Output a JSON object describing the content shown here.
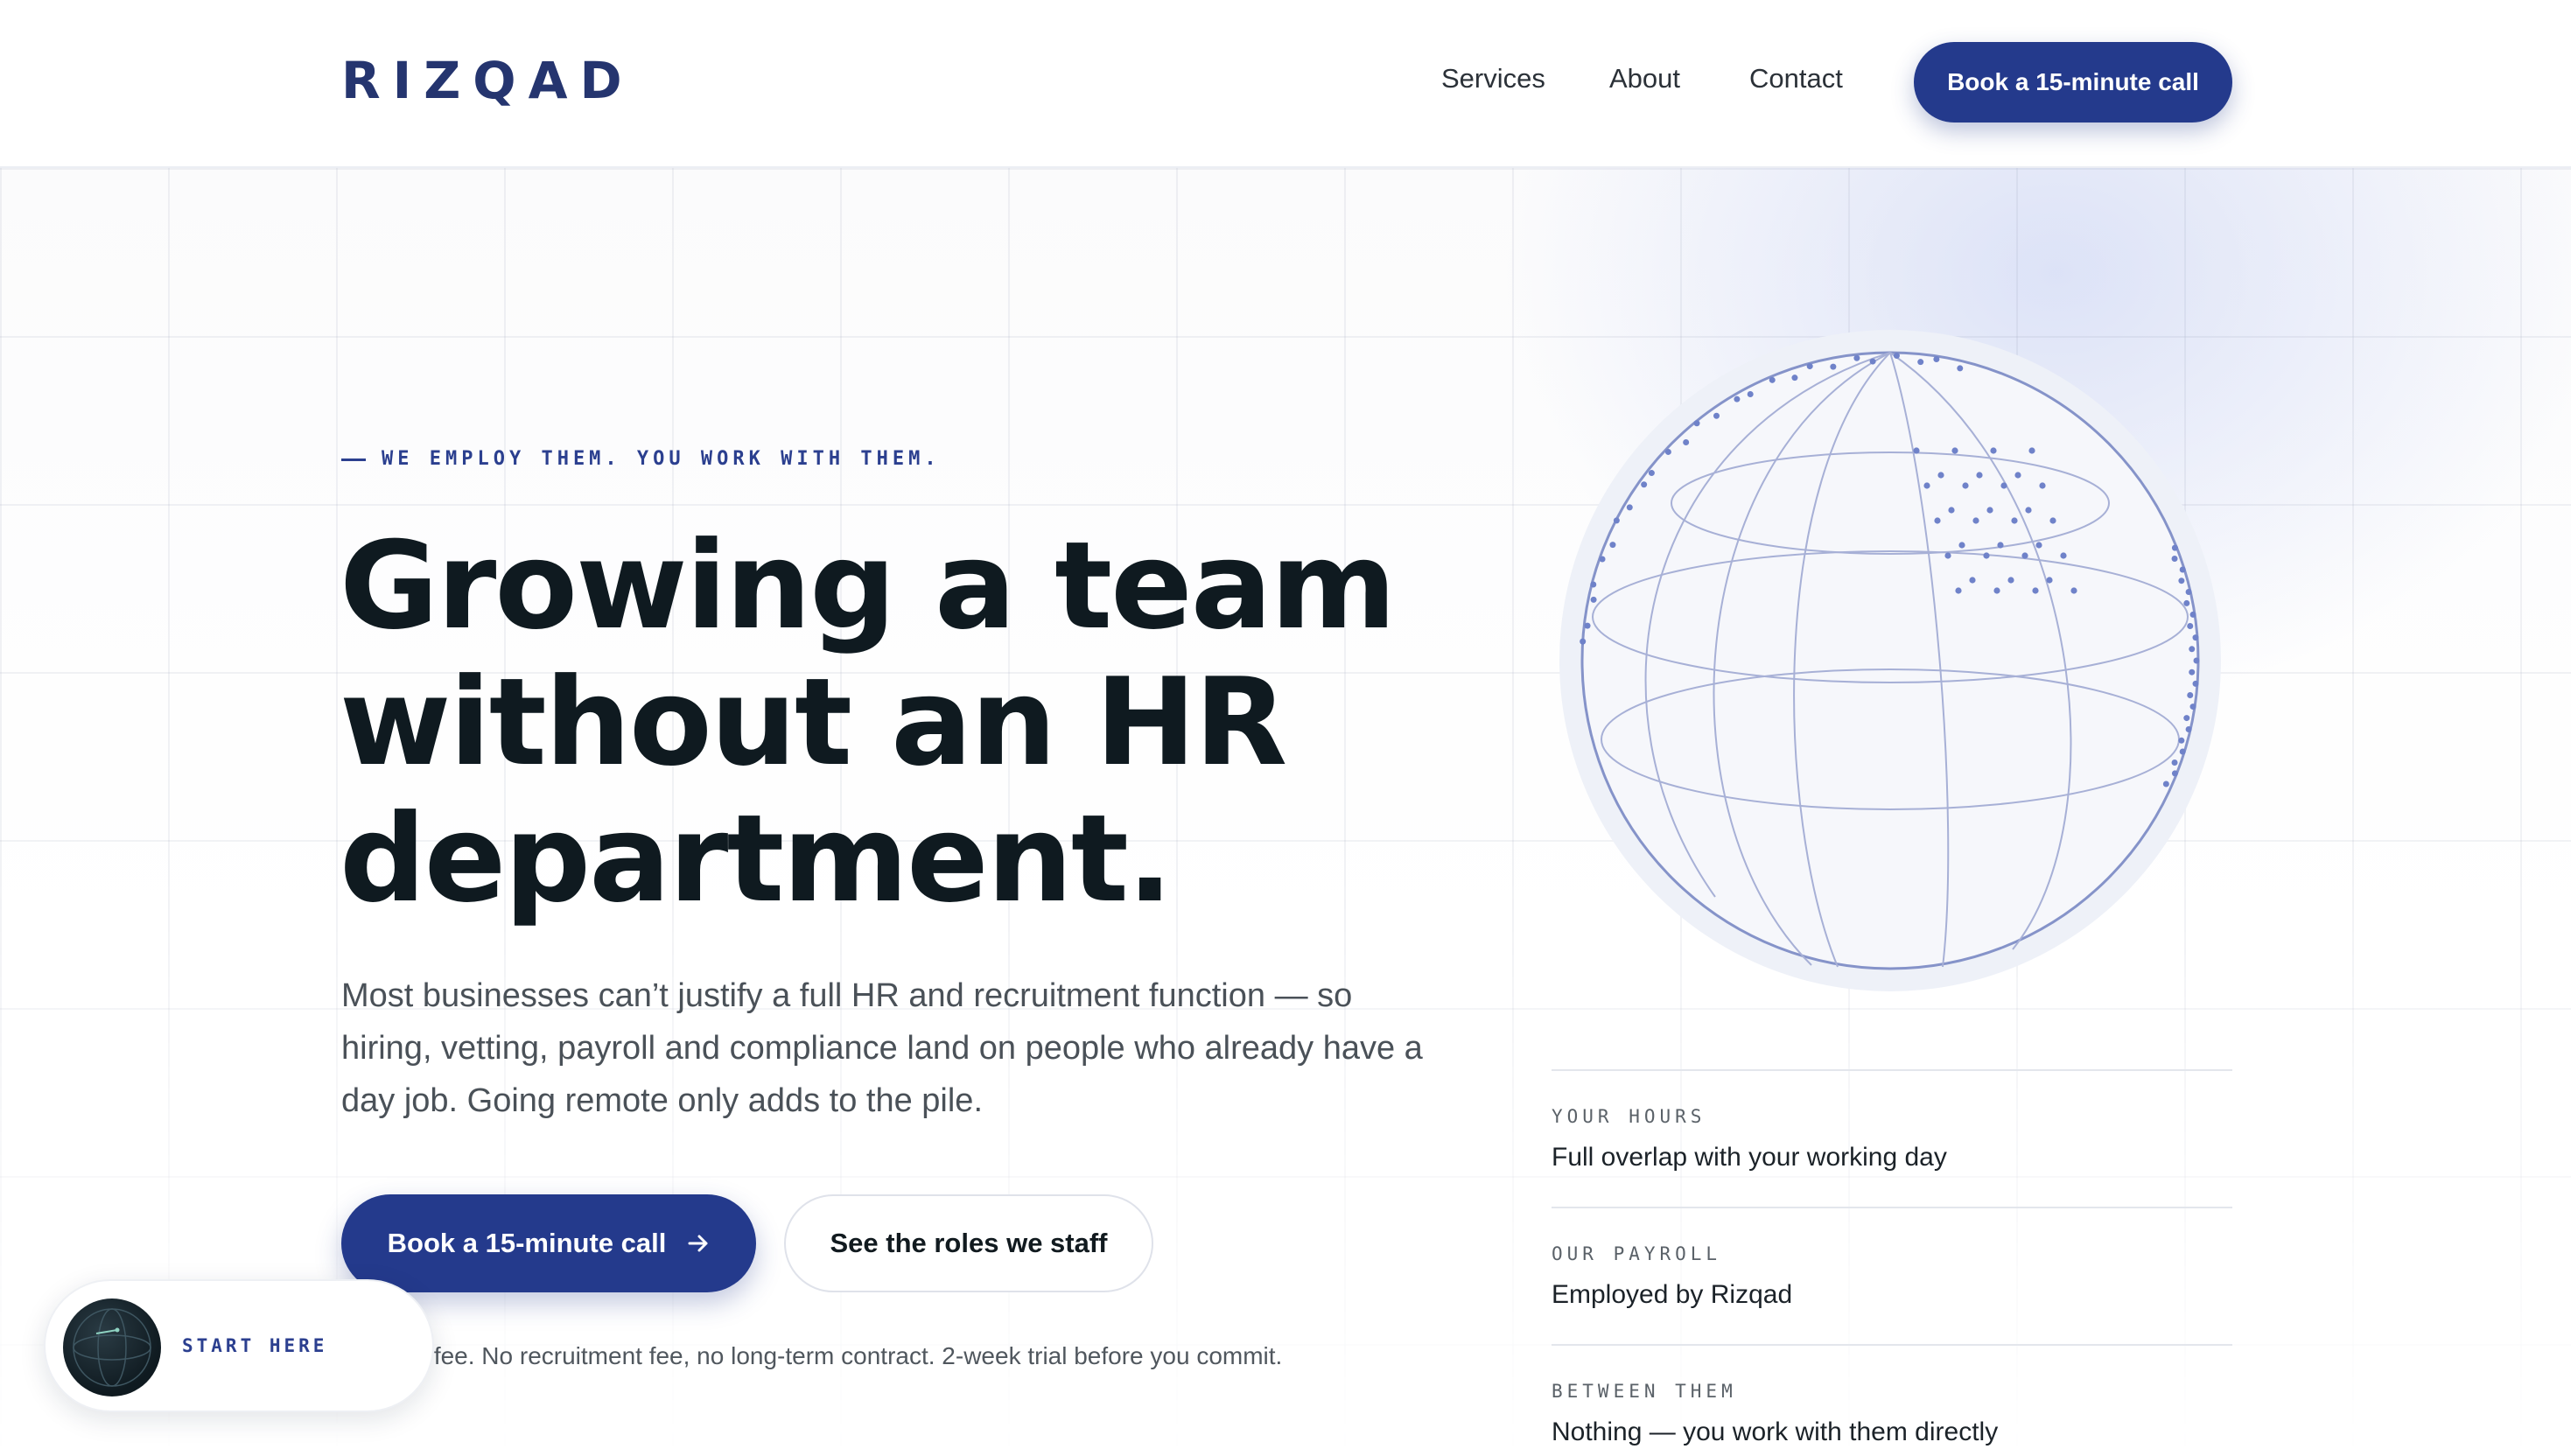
{
  "brand": {
    "logo_text": "RIZQAD",
    "accent_color": "#243a8c",
    "ink_color": "#0f1a20"
  },
  "nav": {
    "items": [
      {
        "label": "Services"
      },
      {
        "label": "About"
      },
      {
        "label": "Contact"
      }
    ],
    "cta_label": "Book a 15-minute call"
  },
  "hero": {
    "eyebrow": "WE EMPLOY THEM. YOU WORK WITH THEM.",
    "headline_lines": [
      "Growing a team",
      "without an HR",
      "department."
    ],
    "lead": "Most businesses can’t justify a full HR and recruitment function — so hiring, vetting, payroll and compliance land on people who already have a day job. Going remote only adds to the pile.",
    "primary_cta": "Book a 15-minute call",
    "primary_cta_icon": "arrow-right-icon",
    "secondary_cta": "See the roles we staff",
    "note": "monthly fee. No recruitment fee, no long-term contract. 2-week trial before you commit."
  },
  "start_widget": {
    "label": "START HERE",
    "icon": "globe-orb-icon"
  },
  "globe": {
    "icon": "wireframe-globe-icon"
  },
  "info": [
    {
      "label": "YOUR HOURS",
      "value": "Full overlap with your working day"
    },
    {
      "label": "OUR PAYROLL",
      "value": "Employed by Rizqad"
    },
    {
      "label": "BETWEEN THEM",
      "value": "Nothing — you work with them directly"
    }
  ]
}
